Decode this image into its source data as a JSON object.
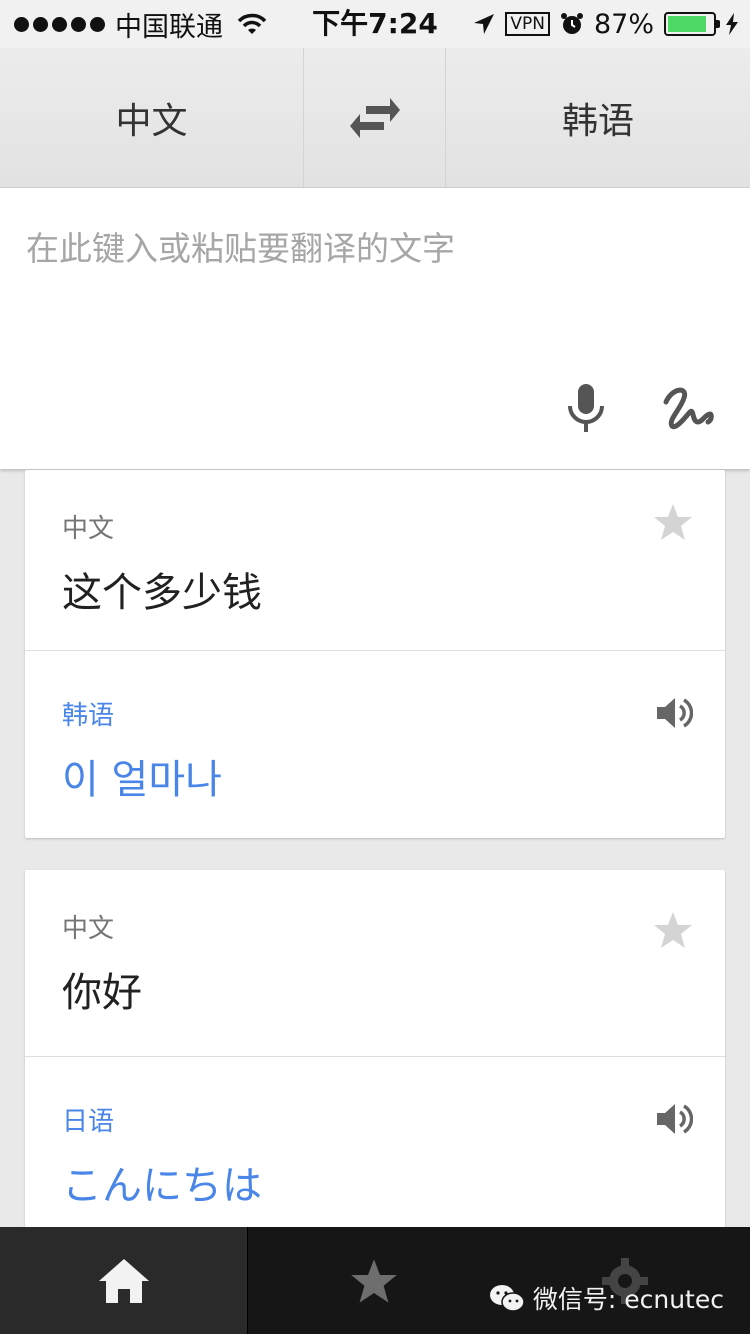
{
  "status_bar": {
    "carrier": "中国联通",
    "time": "下午7:24",
    "vpn": "VPN",
    "battery": "87%",
    "battery_level": 0.87
  },
  "language_bar": {
    "source": "中文",
    "target": "韩语"
  },
  "input": {
    "placeholder": "在此键入或粘贴要翻译的文字"
  },
  "history": [
    {
      "source_lang": "中文",
      "source_text": "这个多少钱",
      "target_lang": "韩语",
      "target_text": "이 얼마나"
    },
    {
      "source_lang": "中文",
      "source_text": "你好",
      "target_lang": "日语",
      "target_text": "こんにちは"
    }
  ],
  "watermark": {
    "text": "微信号: ecnutec"
  },
  "colors": {
    "accent": "#4a86e8",
    "battery": "#4cd964"
  }
}
